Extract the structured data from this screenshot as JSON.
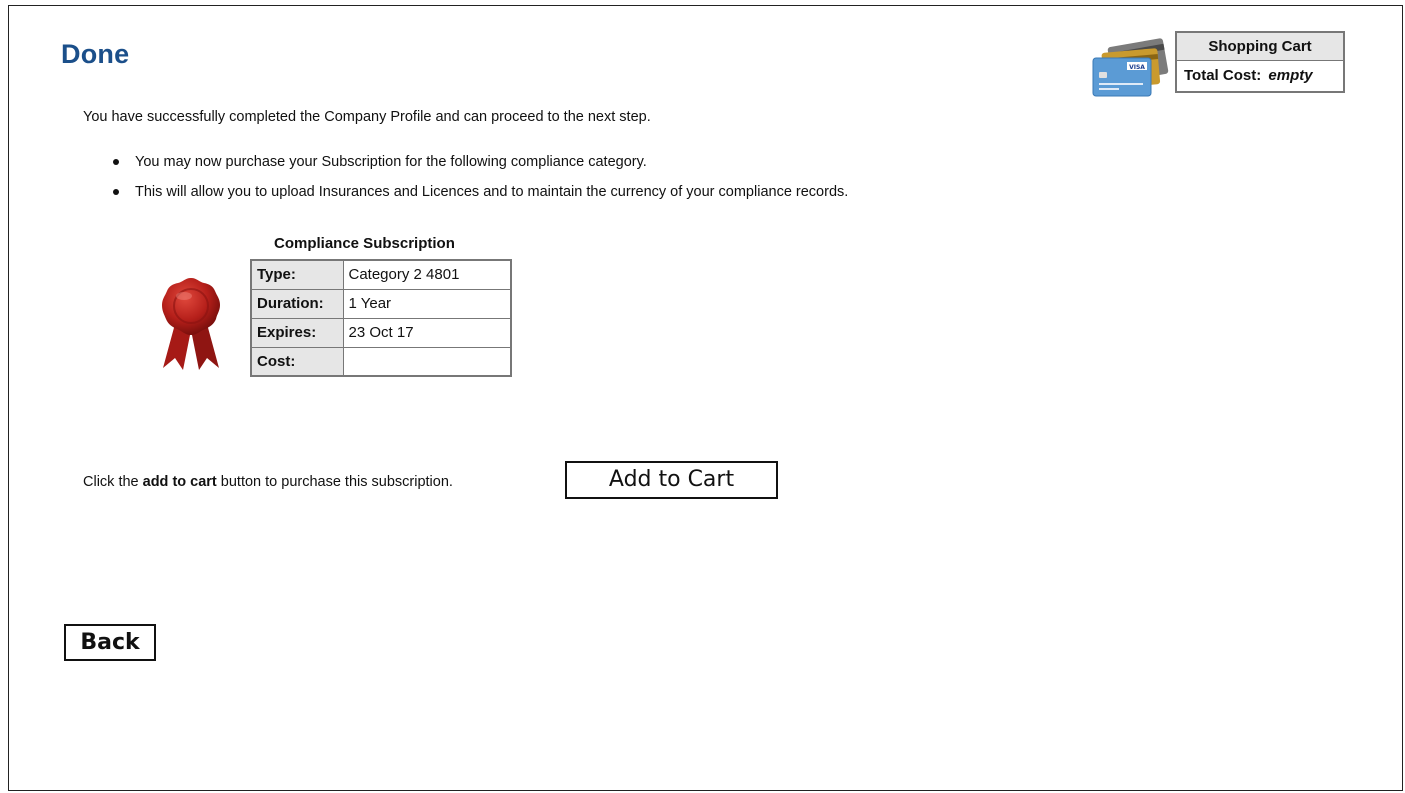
{
  "page": {
    "title": "Done",
    "intro": "You have successfully completed the Company Profile and can proceed to the next step.",
    "bullets": [
      "You may now purchase your Subscription for the following compliance category.",
      "This will allow you to upload Insurances and Licences and to maintain the currency of your compliance records."
    ]
  },
  "cart": {
    "heading": "Shopping Cart",
    "total_label": "Total Cost:",
    "total_value": "empty",
    "icon": "credit-cards-icon"
  },
  "subscription": {
    "heading": "Compliance Subscription",
    "icon": "award-seal-icon",
    "rows": [
      {
        "label": "Type:",
        "value": "Category 2 4801"
      },
      {
        "label": "Duration:",
        "value": "1 Year"
      },
      {
        "label": "Expires:",
        "value": "23 Oct 17"
      },
      {
        "label": "Cost:",
        "value": ""
      }
    ]
  },
  "cta": {
    "prefix": "Click the ",
    "bold": "add to cart",
    "suffix": " button to purchase this subscription.",
    "button_label": "Add to Cart"
  },
  "nav": {
    "back_label": "Back"
  },
  "colors": {
    "title": "#1b4f8a",
    "table_header_bg": "#e6e6e6",
    "border": "#777777"
  }
}
